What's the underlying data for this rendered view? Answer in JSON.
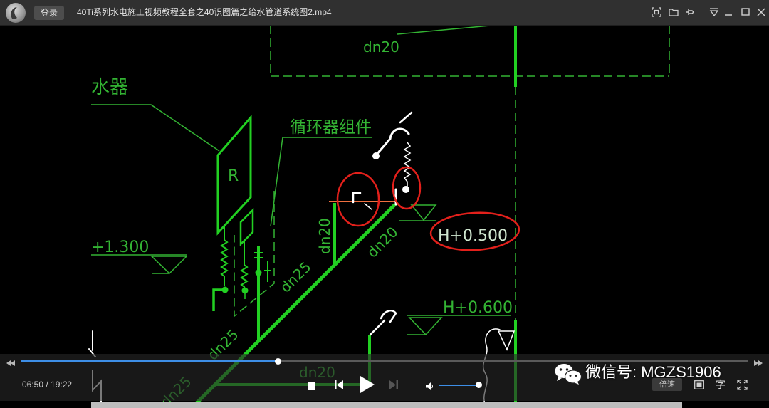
{
  "window": {
    "login_label": "登录",
    "title": "40Ti系列水电施工视频教程全套之40识图篇之给水管道系统图2.mp4",
    "icons": [
      "app-logo-icon",
      "screenshot-icon",
      "folder-icon",
      "pin-icon",
      "menu-dropdown-icon",
      "minimize-icon",
      "maximize-icon",
      "close-icon"
    ]
  },
  "drawing": {
    "label_pipe_top": "dn20",
    "label_heater": "水器",
    "label_heater_symbol": "R",
    "label_circulator": "循环器组件",
    "elevation_1": "+1.300",
    "elevation_2": "H+0.500",
    "elevation_3": "H+0.600",
    "pipe_labels": [
      "dn20",
      "dn20",
      "dn25",
      "dn25",
      "dn20",
      "dn25"
    ]
  },
  "player": {
    "time_text": "06:50 / 19:22",
    "progress": 0.353,
    "volume": 1.0,
    "speed_label": "倍速",
    "subtitle_label": "字",
    "icons": [
      "rewind-icon",
      "forward-icon",
      "stop-icon",
      "previous-icon",
      "play-icon",
      "next-icon",
      "volume-icon",
      "pip-icon",
      "fullscreen-icon"
    ]
  },
  "watermark": {
    "text": "微信号: MGZS1906",
    "icon": "wechat-icon"
  },
  "colors": {
    "accent": "#3d8ee6",
    "cad_green": "#33b333",
    "pipe_green": "#22d022",
    "markup_red": "#e3201b"
  }
}
